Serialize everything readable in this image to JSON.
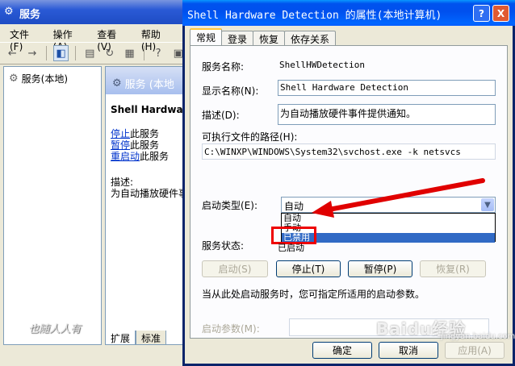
{
  "bg_window": {
    "title": "服务",
    "menu": [
      "文件(F)",
      "操作(A)",
      "查看(V)",
      "帮助(H)"
    ],
    "tree_item": "服务(本地)",
    "pane_header": "服务 (本地",
    "service_name": "Shell Hardware",
    "links": [
      {
        "link": "停止",
        "rest": "此服务"
      },
      {
        "link": "暂停",
        "rest": "此服务"
      },
      {
        "link": "重启动",
        "rest": "此服务"
      }
    ],
    "desc_label": "描述:",
    "desc_text": "为自动播放硬件事",
    "tabs": [
      "扩展",
      "标准"
    ],
    "watermark": "也随人人有"
  },
  "dialog": {
    "title": "Shell Hardware Detection 的属性(本地计算机)",
    "help_label": "?",
    "close_label": "X",
    "tabs": [
      "常规",
      "登录",
      "恢复",
      "依存关系"
    ],
    "service_name_label": "服务名称:",
    "service_name_value": "ShellHWDetection",
    "display_name_label": "显示名称(N):",
    "display_name_value": "Shell Hardware Detection",
    "description_label": "描述(D):",
    "description_value": "为自动播放硬件事件提供通知。",
    "exe_path_label": "可执行文件的路径(H):",
    "exe_path_value": "C:\\WINXP\\WINDOWS\\System32\\svchost.exe -k netsvcs",
    "startup_type_label": "启动类型(E):",
    "startup_type_value": "自动",
    "startup_options": [
      "自动",
      "手动",
      "已禁用"
    ],
    "service_status_label": "服务状态:",
    "service_status_value": "已启动",
    "btn_start": "启动(S)",
    "btn_stop": "停止(T)",
    "btn_pause": "暂停(P)",
    "btn_resume": "恢复(R)",
    "hint_text": "当从此处启动服务时，您可指定所适用的启动参数。",
    "start_params_label": "启动参数(M):",
    "btn_ok": "确定",
    "btn_cancel": "取消",
    "btn_apply": "应用(A)"
  },
  "watermark": {
    "brand": "Baidu经验",
    "sub": "jingyan.baidu.com"
  },
  "colors": {
    "annotation_red": "#e00000",
    "selection_blue": "#316ac5"
  }
}
